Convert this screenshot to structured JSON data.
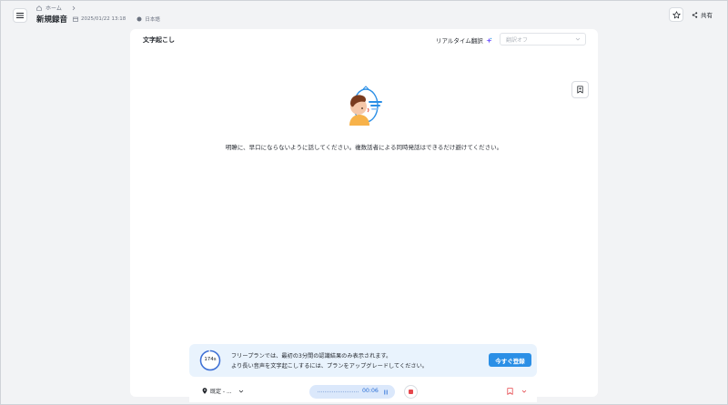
{
  "header": {
    "breadcrumb": "ホーム",
    "title": "新規録音",
    "datetime": "2025/01/22 13:18",
    "language": "日本語",
    "share_label": "共有"
  },
  "card": {
    "title": "文字起こし",
    "realtime_label": "リアルタイム翻訳",
    "translation_select": "翻訳オフ",
    "instruction": "明瞭に、早口にならないように話してください。複数話者による同時発話はできるだけ避けてください。"
  },
  "banner": {
    "timer": "174s",
    "timer_fraction": 0.97,
    "line1": "フリープランでは、最初の3分間の認識結果のみ表示されます。",
    "line2": "より長い音声を文字起こしするには、プランをアップグレードしてください。",
    "register_label": "今すぐ登録"
  },
  "controls": {
    "mic_label": "既定 - ...",
    "elapsed": "00:06"
  },
  "colors": {
    "accent": "#2b8fe6",
    "stop": "#e5484d",
    "banner_bg": "#e9f3fd"
  }
}
